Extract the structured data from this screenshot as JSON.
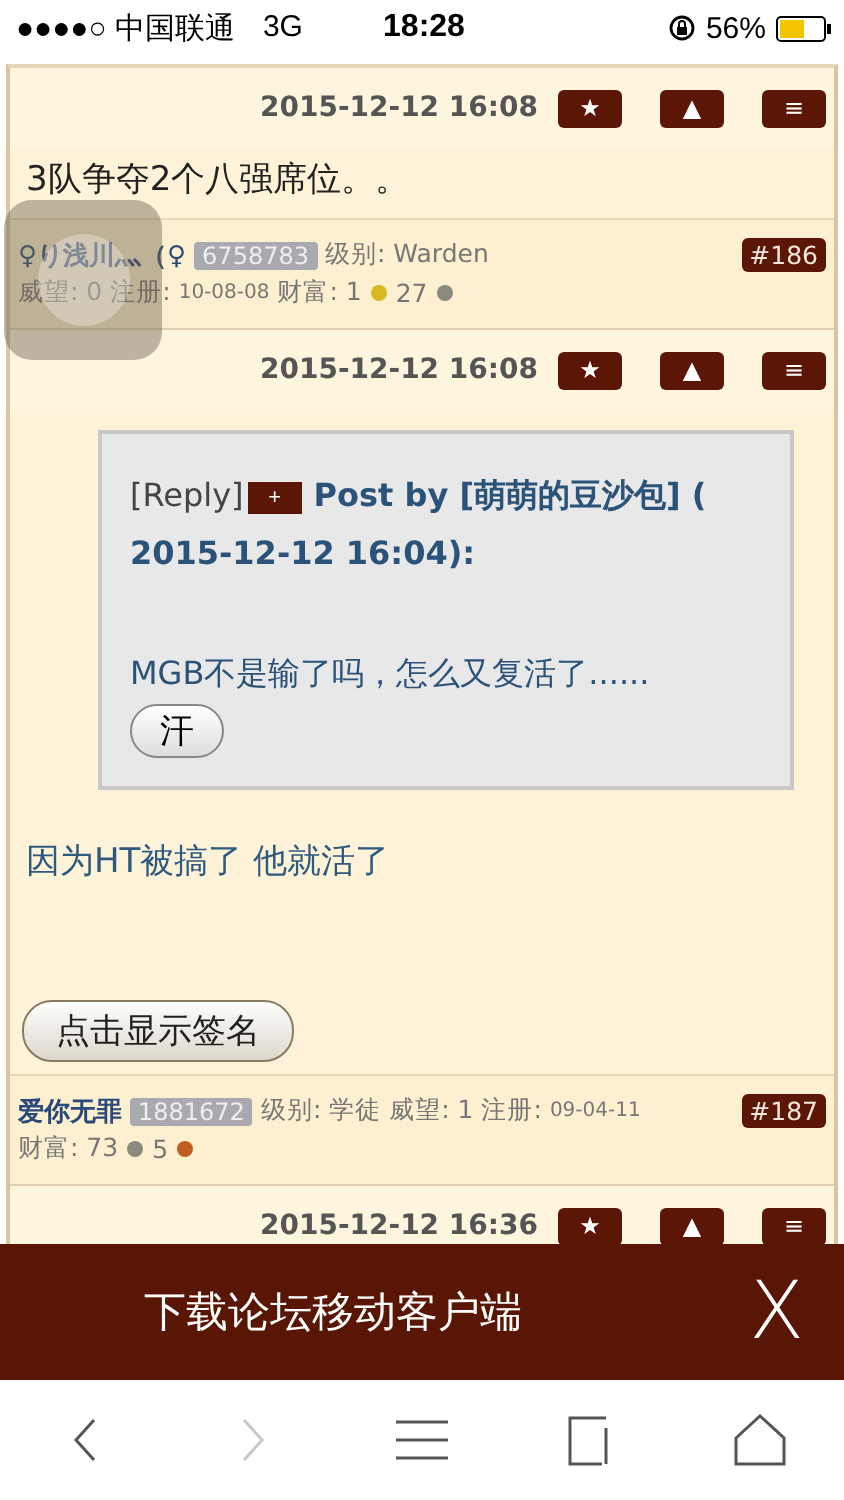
{
  "status_bar": {
    "carrier": "●●●●○ 中国联通",
    "network": "3G",
    "time": "18:28",
    "battery": "56%"
  },
  "posts": [
    {
      "date": "2015-12-12 16:08",
      "actions": [
        "★",
        "▲",
        "≡"
      ],
      "body": "3队争夺2个八强席位。。",
      "user": {
        "name": "♀り浅川灬（♀",
        "uid": "6758783",
        "floor": "#186",
        "lines": [
          [
            {
              "kind": "text",
              "text": "级别: Warden"
            }
          ],
          [
            {
              "kind": "text",
              "text": "威望: 0 注册:"
            },
            {
              "kind": "date",
              "text": "10-08-08"
            },
            {
              "kind": "text",
              "text": "财富: 1"
            },
            {
              "kind": "coin",
              "color": "#d8b820"
            },
            {
              "kind": "text",
              "text": "27"
            },
            {
              "kind": "coin",
              "color": "#8a8a80"
            }
          ]
        ]
      }
    },
    {
      "date": "2015-12-12 16:08",
      "actions": [
        "★",
        "▲",
        "≡"
      ],
      "quote": {
        "reply": "[Reply]",
        "add": "+",
        "header_lines": [
          "Post by [萌萌的豆沙包] (",
          "2015-12-12 16:04):"
        ],
        "text": "MGB不是输了吗，怎么又复活了......",
        "emote": "汗"
      },
      "body": "因为HT被搞了 他就活了",
      "signature_button": "点击显示签名",
      "user": {
        "name": "爱你无罪",
        "uid": "1881672",
        "floor": "#187",
        "lines": [
          [
            {
              "kind": "text",
              "text": "级别: 学徒 威望: 1 注册:"
            },
            {
              "kind": "date",
              "text": "09-04-11"
            }
          ],
          [
            {
              "kind": "text",
              "text": "财富: 73"
            },
            {
              "kind": "coin",
              "color": "#8a8a80"
            },
            {
              "kind": "text",
              "text": "5"
            },
            {
              "kind": "coin",
              "color": "#c06020"
            }
          ]
        ]
      }
    },
    {
      "date": "2015-12-12 16:36",
      "actions": [
        "★",
        "▲",
        "≡"
      ]
    }
  ],
  "banner": {
    "text": "下载论坛移动客户端",
    "close": "X"
  },
  "nav": [
    {
      "kind": "back",
      "disabled": false
    },
    {
      "kind": "forward",
      "disabled": true
    },
    {
      "kind": "menu",
      "disabled": false
    },
    {
      "kind": "tabs",
      "disabled": false
    },
    {
      "kind": "home",
      "disabled": false
    }
  ]
}
